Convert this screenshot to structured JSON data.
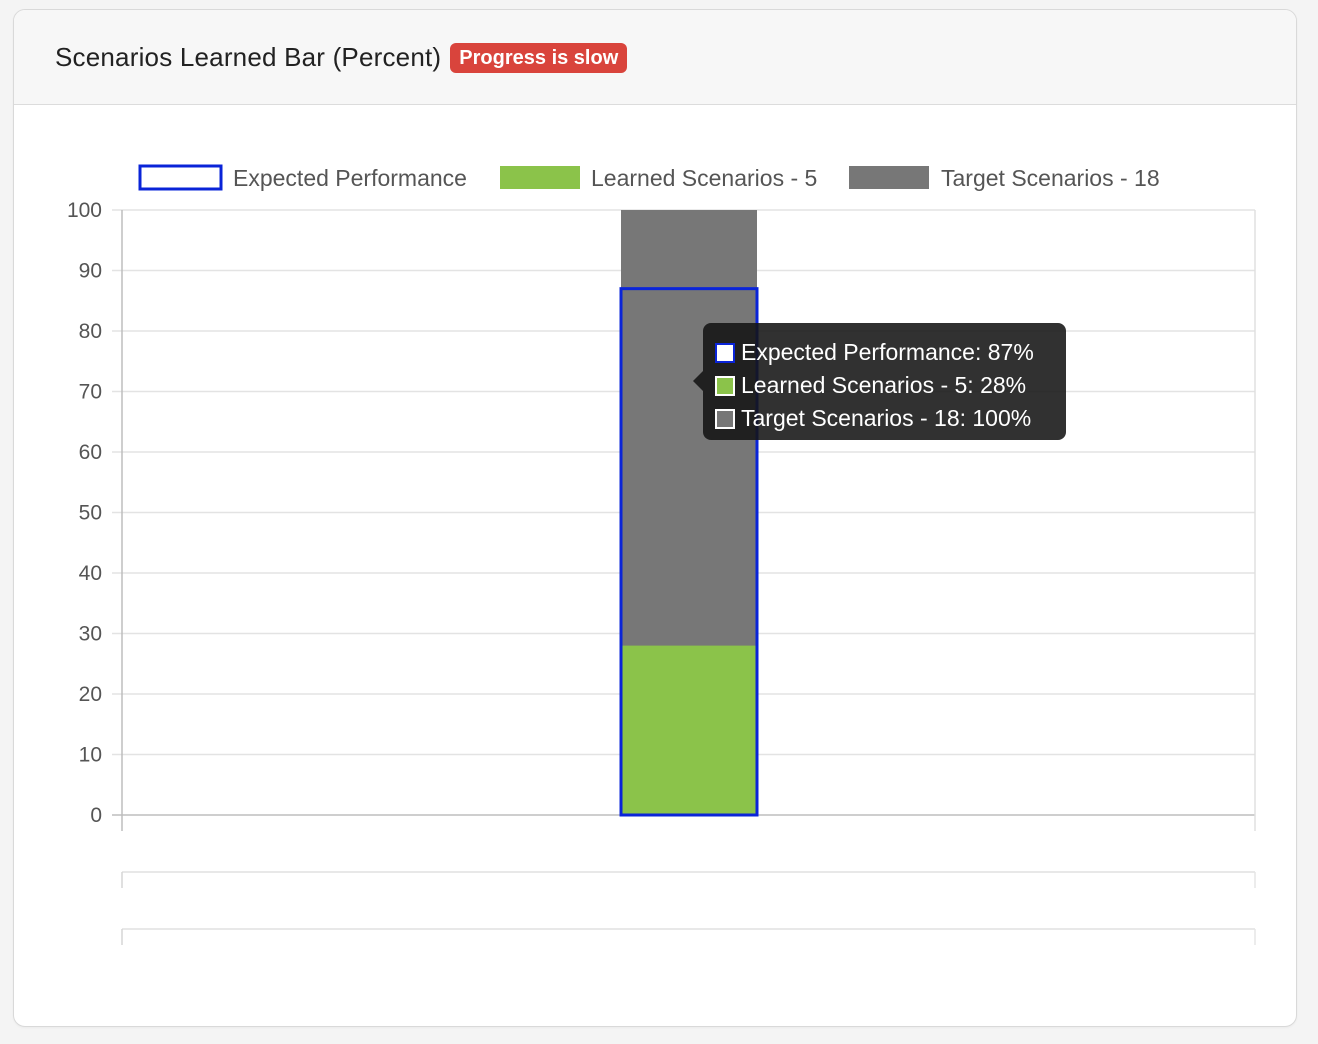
{
  "card": {
    "title": "Scenarios Learned Bar (Percent)",
    "badge": "Progress is slow",
    "badge_color": "#d9443c"
  },
  "legend": [
    {
      "label": "Expected Performance",
      "fill": "#ffffff",
      "border": "#0a24d8",
      "style": "outline"
    },
    {
      "label": "Learned Scenarios - 5",
      "fill": "#8bc34a",
      "border": "#8bc34a",
      "style": "filled"
    },
    {
      "label": "Target Scenarios - 18",
      "fill": "#777777",
      "border": "#777777",
      "style": "filled"
    }
  ],
  "tooltip": {
    "rows": [
      {
        "text": "Expected Performance: 87%",
        "swatch": "#ffffff",
        "swatch_border": "#0a24d8"
      },
      {
        "text": "Learned Scenarios - 5: 28%",
        "swatch": "#8bc34a",
        "swatch_border": "#ffffff"
      },
      {
        "text": "Target Scenarios - 18: 100%",
        "swatch": "#777777",
        "swatch_border": "#ffffff"
      }
    ]
  },
  "chart_data": {
    "type": "bar",
    "stacked": false,
    "overlapping_bars": true,
    "categories": [
      ""
    ],
    "series": [
      {
        "name": "Target Scenarios - 18",
        "values": [
          100
        ],
        "color": "#777777"
      },
      {
        "name": "Learned Scenarios - 5",
        "values": [
          28
        ],
        "color": "#8bc34a"
      },
      {
        "name": "Expected Performance",
        "values": [
          87
        ],
        "color": "#0a24d8",
        "style": "outline"
      }
    ],
    "yticks": [
      "0",
      "10",
      "20",
      "30",
      "40",
      "50",
      "60",
      "70",
      "80",
      "90",
      "100"
    ],
    "ylim": [
      0,
      100
    ],
    "grid": true,
    "legend_position": "top-left"
  }
}
